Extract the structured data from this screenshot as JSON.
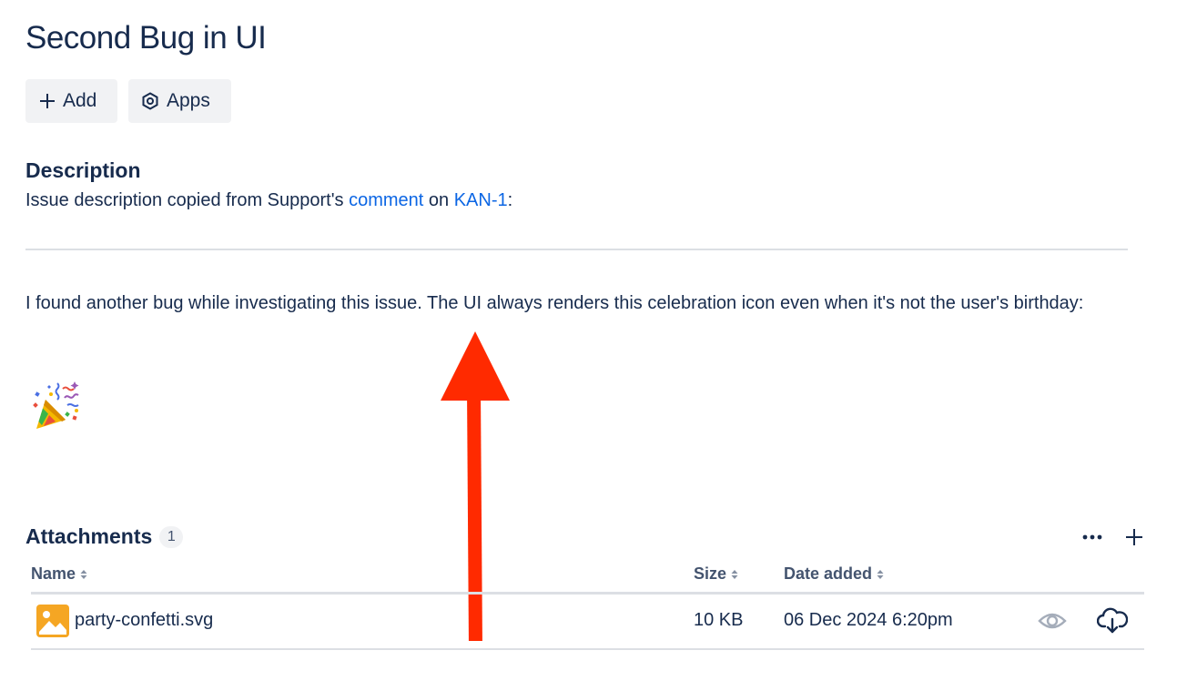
{
  "issue": {
    "title": "Second Bug in UI"
  },
  "toolbar": {
    "add_label": "Add",
    "apps_label": "Apps"
  },
  "description": {
    "heading": "Description",
    "prefix": "Issue description copied from Support's ",
    "comment_link": "comment",
    "on_text": " on ",
    "issue_link": "KAN-1",
    "suffix": ":",
    "body": "I found another bug while investigating this issue. The UI always renders this celebration icon even when it's not the user's birthday:",
    "emoji_icon": "party-popper-icon"
  },
  "annotation": {
    "arrow_color": "#ff2a00",
    "arrow_icon": "red-arrow-up"
  },
  "attachments": {
    "heading": "Attachments",
    "count": "1",
    "columns": {
      "name": "Name",
      "size": "Size",
      "date": "Date added"
    },
    "rows": [
      {
        "icon": "image-file-icon",
        "name": "party-confetti.svg",
        "size": "10 KB",
        "date": "06 Dec 2024 6:20pm"
      }
    ]
  },
  "colors": {
    "text": "#172b4d",
    "link": "#0c66e4",
    "button_bg": "#f1f2f4",
    "subtle_text": "#44546f",
    "file_icon": "#f5a623"
  }
}
